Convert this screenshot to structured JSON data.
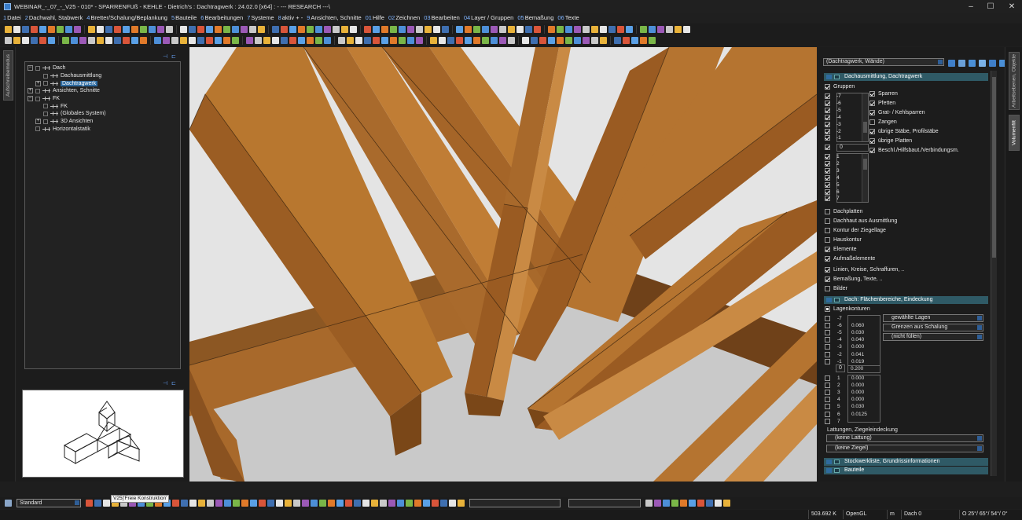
{
  "window": {
    "title": "WEBINAR_-_07_-_V25 - 010* - SPARRENFUß - KEHLE - Dietrich's : Dachtragwerk : 24.02.0 [x64] : - --- RESEARCH ---\\",
    "controls": [
      "–",
      "☐",
      "✕"
    ]
  },
  "menu": [
    {
      "num": "1",
      "label": "Datei"
    },
    {
      "num": "2",
      "label": "Dachwahl, Stabwerk"
    },
    {
      "num": "4",
      "label": "Bretter/Schalung/Beplankung"
    },
    {
      "num": "5",
      "label": "Bauteile"
    },
    {
      "num": "6",
      "label": "Bearbeitungen"
    },
    {
      "num": "7",
      "label": "Systeme"
    },
    {
      "num": "8",
      "label": "aktiv + -"
    },
    {
      "num": "9",
      "label": "Ansichten, Schnitte"
    },
    {
      "num": "01",
      "label": "Hilfe"
    },
    {
      "num": "02",
      "label": "Zeichnen"
    },
    {
      "num": "03",
      "label": "Bearbeiten"
    },
    {
      "num": "04",
      "label": "Layer / Gruppen"
    },
    {
      "num": "05",
      "label": "Bemaßung"
    },
    {
      "num": "06",
      "label": "Texte"
    }
  ],
  "left_strip": {
    "tab": "Aufschreibemodus"
  },
  "tree": {
    "items": [
      {
        "label": "Dach",
        "level": 0,
        "expander": "⊟"
      },
      {
        "label": "Dachausmittlung",
        "level": 1,
        "expander": ""
      },
      {
        "label": "Dachtragwerk",
        "level": 1,
        "expander": "⊞",
        "selected": true
      },
      {
        "label": "Ansichten, Schnitte",
        "level": 0,
        "expander": "⊞"
      },
      {
        "label": "FK",
        "level": 0,
        "expander": "⊟"
      },
      {
        "label": "FK",
        "level": 1,
        "expander": ""
      },
      {
        "label": "(Globales System)",
        "level": 1,
        "expander": ""
      },
      {
        "label": "3D Ansichten",
        "level": 1,
        "expander": "⊞"
      },
      {
        "label": "Horizontalstatik",
        "level": 0,
        "expander": ""
      }
    ]
  },
  "right_panel": {
    "dropdown": "(Dachtragwerk, Wände)",
    "section1": "Dachausmittlung, Dachtragwerk",
    "gruppen_label": "Gruppen",
    "neg_groups": [
      "-7",
      "-6",
      "-5",
      "-4",
      "-3",
      "-2",
      "-1"
    ],
    "zero_group": "0",
    "pos_groups": [
      "1",
      "2",
      "3",
      "4",
      "5",
      "6",
      "7"
    ],
    "elements": [
      {
        "label": "Sparren",
        "checked": true
      },
      {
        "label": "Pfetten",
        "checked": true
      },
      {
        "label": "Grat- / Kehlsparren",
        "checked": true
      },
      {
        "label": "Zangen",
        "checked": false
      },
      {
        "label": "übrige Stäbe, Profilstäbe",
        "checked": true
      },
      {
        "label": "übrige Platten",
        "checked": true
      },
      {
        "label": "Beschl./Hilfsbaut./Verbindungsm.",
        "checked": true
      }
    ],
    "options1": [
      {
        "label": "Dachplatten",
        "checked": false
      },
      {
        "label": "Dachhaut aus Ausmittlung",
        "checked": false
      },
      {
        "label": "Kontur der Ziegellage",
        "checked": false
      },
      {
        "label": "Hauskontur",
        "checked": false
      },
      {
        "label": "Elemente",
        "checked": true
      },
      {
        "label": "Aufmaßelemente",
        "checked": true
      }
    ],
    "options2": [
      {
        "label": "Linien, Kreise, Schraffuren, ..",
        "checked": true
      },
      {
        "label": "Bemaßung, Texte, ..",
        "checked": true
      },
      {
        "label": "Bilder",
        "checked": false
      }
    ],
    "section2": "Dach: Flächenbereiche, Eindeckung",
    "lagenkonturen": "Lagenkonturen",
    "neg_values": [
      "",
      "0.060",
      "0.030",
      "0.040",
      "0.000",
      "0.041",
      "0.019"
    ],
    "zero_value": "0.200",
    "pos_values": [
      "0.000",
      "0.000",
      "0.000",
      "0.000",
      "0.030",
      "0.0125",
      ""
    ],
    "lagen_dropdowns": [
      "gewählte Lagen",
      "Grenzen aus Schalung",
      "(nicht füllen)"
    ],
    "lattung_label": "Lattungen, Ziegeleindeckung",
    "lattung_dropdowns": [
      "(keine Lattung)",
      "(keine Ziegel)"
    ],
    "section3": "Stockwerkliste, Grundrissinformationen",
    "section4": "Bauteile"
  },
  "right_strip": {
    "tabs": [
      "Arbeitsebenen, Objekte",
      "Volumenfilt"
    ]
  },
  "bottom": {
    "style": "Standard",
    "tooltip": "V25|'Freie Konstruktion'"
  },
  "status": {
    "coord": "503.692 K",
    "renderer": "OpenGL",
    "unit": "m",
    "layer": "Dach 0",
    "view": "O 25°/ 65°/ 54°/ 0°"
  },
  "colors": {
    "accent": "#2f5a66",
    "selection": "#2d6aa0",
    "wood_top": "#b0702f",
    "wood_side": "#7a4718"
  }
}
